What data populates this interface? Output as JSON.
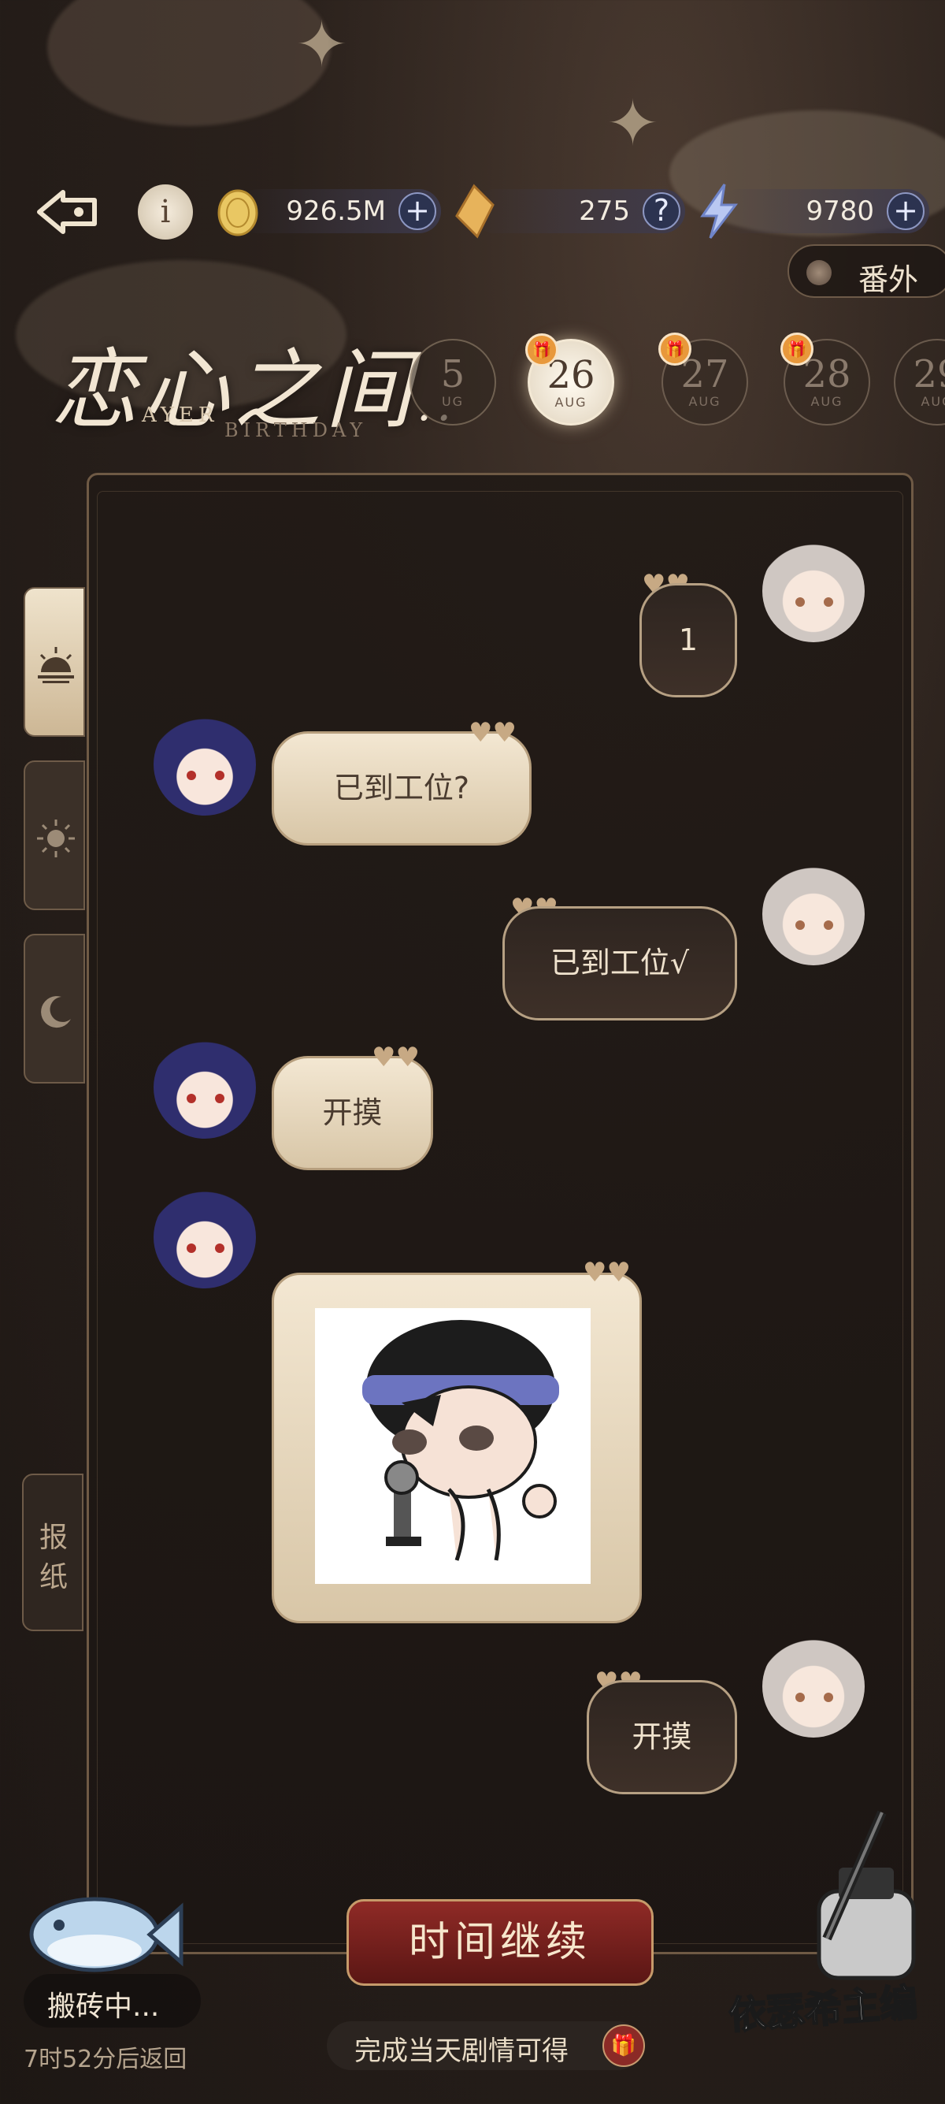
{
  "resources": {
    "coins": "926.5M",
    "diamonds": "275",
    "energy": "9780",
    "plus": "+",
    "help": "?"
  },
  "extra_button": "番外",
  "title": {
    "main": "恋心之间",
    "ellipsis": "..",
    "sub_a": "AYER",
    "sub_b": "BIRTHDAY"
  },
  "dates": [
    {
      "day": "5",
      "month": "UG",
      "gift": false,
      "active": false
    },
    {
      "day": "26",
      "month": "AUG",
      "gift": true,
      "active": true
    },
    {
      "day": "27",
      "month": "AUG",
      "gift": true,
      "active": false
    },
    {
      "day": "28",
      "month": "AUG",
      "gift": true,
      "active": false
    },
    {
      "day": "29",
      "month": "AUG",
      "gift": false,
      "active": false
    }
  ],
  "chat": [
    {
      "from": "me",
      "text": "1"
    },
    {
      "from": "them",
      "text": "已到工位?"
    },
    {
      "from": "me",
      "text": "已到工位√"
    },
    {
      "from": "them",
      "text": "开摸"
    },
    {
      "from": "them",
      "type": "sticker"
    },
    {
      "from": "me",
      "text": "开摸"
    }
  ],
  "side_tabs": [
    "sunrise-icon",
    "sun-icon",
    "moon-icon"
  ],
  "paper_tab": {
    "c1": "报",
    "c2": "纸"
  },
  "continue_button": "时间继续",
  "reward_hint": "完成当天剧情可得",
  "working": {
    "status": "搬砖中...",
    "return": "7时52分后返回"
  },
  "editor_mark": "依瑟希主编",
  "colors": {
    "accent": "#8f2a26",
    "gold": "#c69a6a",
    "cream": "#f3e7d2"
  }
}
